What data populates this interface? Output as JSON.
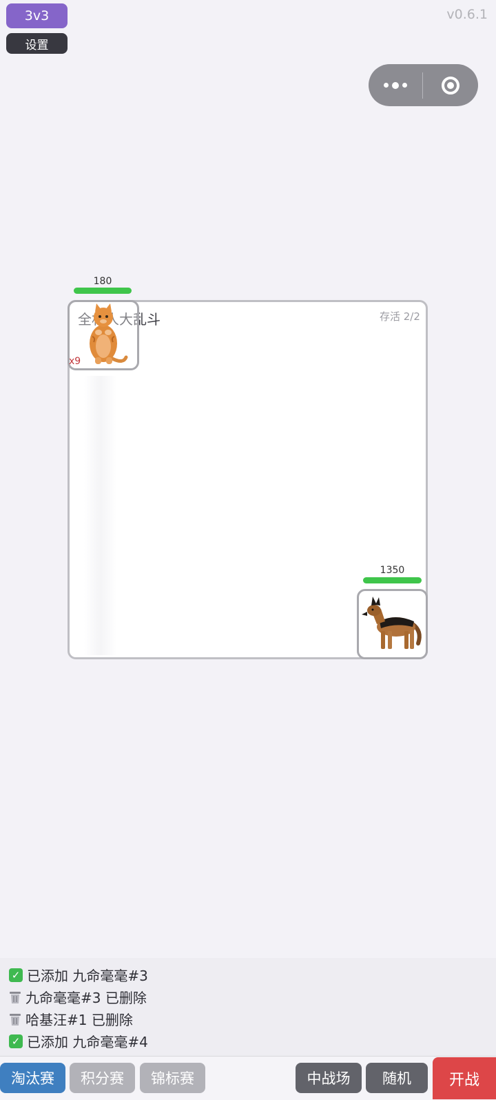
{
  "header": {
    "mode_label": "3v3",
    "settings_label": "设置",
    "version": "v0.6.1"
  },
  "capsule": {
    "more_icon": "more-dots-icon",
    "close_icon": "target-circle-icon"
  },
  "arena": {
    "title": "全村人大乱斗",
    "survive": "存活 2/2",
    "fighters": [
      {
        "name": "cat",
        "hp": "180",
        "hp_fill": 1.0,
        "multiplier": "x9",
        "icon": "orange-cat"
      },
      {
        "name": "dog",
        "hp": "1350",
        "hp_fill": 1.0,
        "icon": "german-shepherd"
      }
    ]
  },
  "log": [
    {
      "icon": "check-icon",
      "text": "已添加 九命毫毫#3"
    },
    {
      "icon": "trash-icon",
      "text": "九命毫毫#3 已删除"
    },
    {
      "icon": "trash-icon",
      "text": "哈基汪#1 已删除"
    },
    {
      "icon": "check-icon",
      "text": "已添加 九命毫毫#4"
    }
  ],
  "bottom": {
    "tabs": [
      "淘汰赛",
      "积分赛",
      "锦标赛"
    ],
    "arena_size": "中战场",
    "random": "随机",
    "start": "开战"
  },
  "colors": {
    "mode": "#8565c9",
    "hp": "#3fc54b",
    "tab_active": "#3f7fc0",
    "start": "#dd4648"
  }
}
